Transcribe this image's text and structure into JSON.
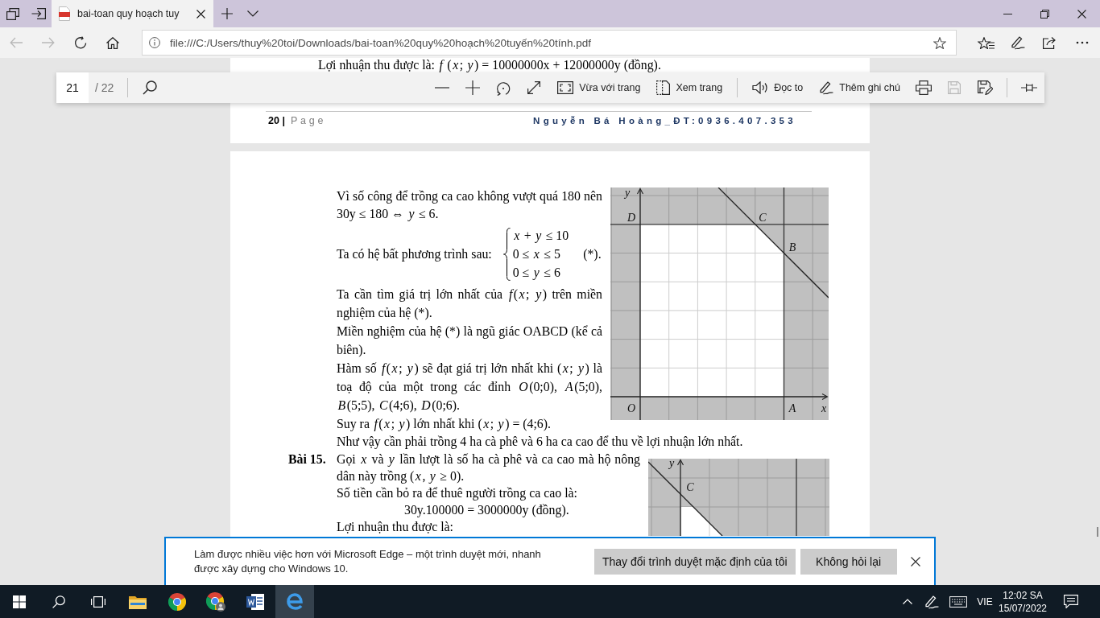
{
  "tabs": [
    {
      "title": "bai-toan quy hoạch tuy",
      "selected": true
    }
  ],
  "navigation": [
    {
      "disabled": true
    },
    {
      "disabled": true
    },
    {
      "disabled": false
    },
    {
      "disabled": false
    }
  ],
  "address_bar": {
    "url": "file:///C:/Users/thuy%20toi/Downloads/bai-toan%20quy%20hoạch%20tuyến%20tính.pdf"
  },
  "pdf_toolbar": {
    "page": "21",
    "page_count": "/ 22",
    "tools": [
      "Vừa với trang",
      "Xem trang",
      "Đọc to",
      "Thêm ghi chú"
    ],
    "actions": [
      {
        "disabled": false
      },
      {
        "disabled": true
      },
      {
        "disabled": false
      }
    ]
  },
  "page_1": {
    "text": "Lợi nhuận thu được là: *f* (*x*; *y*) = 10000000x + 12000000y (đồng).",
    "footer": {
      "page_number": "20 |",
      "page_word": "Page",
      "author": "Nguyễn Bá Hoàng_ĐT:0936.407.353"
    }
  },
  "page_2": {
    "blocks": [
      {
        "kind": "text",
        "text": "Vì số công để trồng ca cao không vượt quá 180 nên 30y ≤ 180 ⇔ *y* ≤ 6."
      },
      {
        "kind": "system",
        "lead": "Ta có hệ bất phương trình sau:",
        "lines": [
          "*x* + *y* ≤ 10",
          "0 ≤ *x* ≤ 5",
          "0 ≤ *y* ≤ 6"
        ],
        "tag": "(*)."
      },
      {
        "kind": "text",
        "text": "Ta cần tìm giá trị lớn nhất của *f*(*x*; *y*) trên miền nghiệm của hệ (*)."
      },
      {
        "kind": "text",
        "text": "Miền nghiệm của hệ (*) là ngũ giác OABCD (kể cả biên)."
      },
      {
        "kind": "text",
        "text": "Hàm số *f*(*x*; *y*) sẽ đạt giá trị lớn nhất khi (*x*; *y*) là toạ độ của một trong các đỉnh *O*(0;0), *A*(5;0), *B*(5;5), *C*(4;6), *D*(0;6)."
      },
      {
        "kind": "text",
        "text": "Suy ra *f*(*x*; *y*) lớn nhất khi (*x*; *y*) = (4;6)."
      }
    ],
    "graph_1": {
      "axes": [
        "x",
        "y"
      ],
      "points": [
        "O",
        "A",
        "B",
        "C",
        "D"
      ]
    },
    "conclusion": "Như vậy cần phải trồng 4 ha cà phê và 6 ha ca cao để thu về lợi nhuận lớn nhất.",
    "exercise": {
      "label": "Bài 15.",
      "blocks": [
        {
          "kind": "text",
          "text": "Gọi *x* và *y* lần lượt là số ha cà phê và ca cao mà hộ nông dân này trồng (*x*, *y* ≥ 0)."
        },
        {
          "kind": "text",
          "text": "Số tiền cần bỏ ra để thuê người trồng ca cao là:"
        },
        {
          "kind": "formula",
          "text": "30y.100000 = 3000000y (đồng)."
        },
        {
          "kind": "text",
          "text": "Lợi nhuận thu được là:"
        }
      ],
      "graph": {
        "axes": [
          "y"
        ],
        "points": [
          "C"
        ]
      }
    }
  },
  "notification": {
    "message": "Làm được nhiều việc hơn với Microsoft Edge – một trình duyệt mới, nhanh được xây dựng cho Windows 10.",
    "buttons": [
      "Thay đổi trình duyệt mặc định của tôi",
      "Không hỏi lại"
    ]
  },
  "taskbar": {
    "apps": [
      {
        "selected": false
      },
      {
        "selected": false
      },
      {
        "selected": false
      },
      {
        "selected": false
      },
      {
        "selected": true
      }
    ],
    "language": "VIE",
    "time": "12:02 SA",
    "date": "15/07/2022"
  }
}
